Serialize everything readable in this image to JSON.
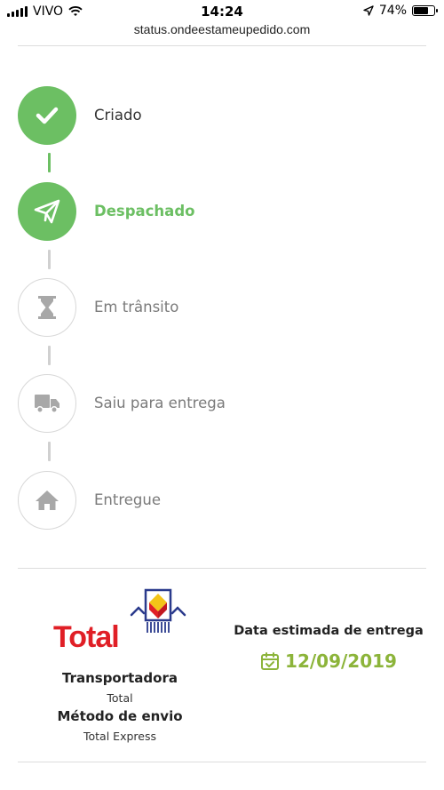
{
  "status_bar": {
    "carrier": "VIVO",
    "time": "14:24",
    "battery": "74%",
    "battery_level": 0.74,
    "icons": [
      "signal-icon",
      "wifi-icon",
      "location-arrow-icon",
      "battery-icon"
    ]
  },
  "browser": {
    "url": "status.ondeestameupedido.com"
  },
  "timeline": {
    "steps": [
      {
        "label": "Criado",
        "icon": "check-icon",
        "state": "done"
      },
      {
        "label": "Despachado",
        "icon": "paper-plane-icon",
        "state": "active"
      },
      {
        "label": "Em trânsito",
        "icon": "hourglass-icon",
        "state": "todo"
      },
      {
        "label": "Saiu para entrega",
        "icon": "truck-icon",
        "state": "todo"
      },
      {
        "label": "Entregue",
        "icon": "home-icon",
        "state": "todo"
      }
    ],
    "colors": {
      "done": "#6cbf63",
      "pending": "#d0d0d0"
    }
  },
  "shipping": {
    "logo_text": "Total",
    "carrier_title": "Transportadora",
    "carrier_value": "Total",
    "method_title": "Método de envio",
    "method_value": "Total Express",
    "eta_title": "Data estimada de entrega",
    "eta_date": "12/09/2019",
    "eta_icon": "calendar-check-icon",
    "colors": {
      "brand": "#e01f26",
      "eta": "#8cb43a"
    }
  }
}
